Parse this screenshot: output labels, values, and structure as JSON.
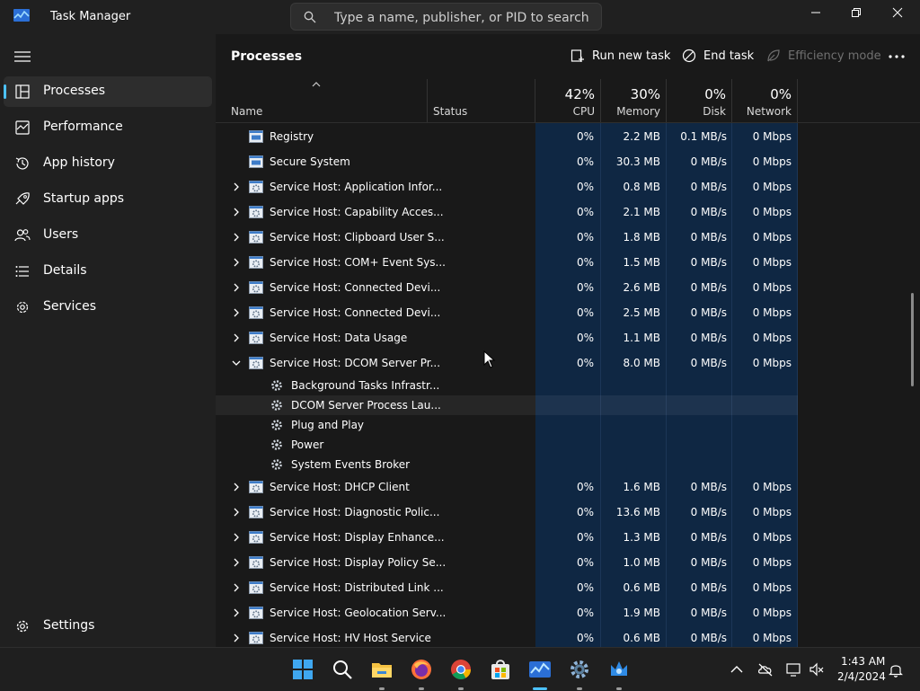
{
  "window": {
    "title": "Task Manager"
  },
  "search": {
    "placeholder": "Type a name, publisher, or PID to search"
  },
  "sidebar": {
    "items": [
      {
        "label": "Processes",
        "icon": "processes-icon",
        "active": true
      },
      {
        "label": "Performance",
        "icon": "performance-icon"
      },
      {
        "label": "App history",
        "icon": "app-history-icon"
      },
      {
        "label": "Startup apps",
        "icon": "startup-apps-icon"
      },
      {
        "label": "Users",
        "icon": "users-icon"
      },
      {
        "label": "Details",
        "icon": "details-icon"
      },
      {
        "label": "Services",
        "icon": "services-icon"
      }
    ],
    "settings_label": "Settings"
  },
  "page": {
    "title": "Processes"
  },
  "commands": {
    "run_new_task": "Run new task",
    "end_task": "End task",
    "efficiency_mode": "Efficiency mode"
  },
  "columns": {
    "name": "Name",
    "status": "Status",
    "cpu": {
      "label": "CPU",
      "percent": "42%"
    },
    "memory": {
      "label": "Memory",
      "percent": "30%"
    },
    "disk": {
      "label": "Disk",
      "percent": "0%"
    },
    "network": {
      "label": "Network",
      "percent": "0%"
    }
  },
  "rows": [
    {
      "name": "Registry",
      "type": "process",
      "expander": "none",
      "cpu": "0%",
      "memory": "2.2 MB",
      "disk": "0.1 MB/s",
      "network": "0 Mbps"
    },
    {
      "name": "Secure System",
      "type": "process",
      "expander": "none",
      "cpu": "0%",
      "memory": "30.3 MB",
      "disk": "0 MB/s",
      "network": "0 Mbps"
    },
    {
      "name": "Service Host: Application Infor...",
      "type": "service",
      "expander": "collapsed",
      "cpu": "0%",
      "memory": "0.8 MB",
      "disk": "0 MB/s",
      "network": "0 Mbps"
    },
    {
      "name": "Service Host: Capability Acces...",
      "type": "service",
      "expander": "collapsed",
      "cpu": "0%",
      "memory": "2.1 MB",
      "disk": "0 MB/s",
      "network": "0 Mbps"
    },
    {
      "name": "Service Host: Clipboard User S...",
      "type": "service",
      "expander": "collapsed",
      "cpu": "0%",
      "memory": "1.8 MB",
      "disk": "0 MB/s",
      "network": "0 Mbps"
    },
    {
      "name": "Service Host: COM+ Event Sys...",
      "type": "service",
      "expander": "collapsed",
      "cpu": "0%",
      "memory": "1.5 MB",
      "disk": "0 MB/s",
      "network": "0 Mbps"
    },
    {
      "name": "Service Host: Connected Devi...",
      "type": "service",
      "expander": "collapsed",
      "cpu": "0%",
      "memory": "2.6 MB",
      "disk": "0 MB/s",
      "network": "0 Mbps"
    },
    {
      "name": "Service Host: Connected Devi...",
      "type": "service",
      "expander": "collapsed",
      "cpu": "0%",
      "memory": "2.5 MB",
      "disk": "0 MB/s",
      "network": "0 Mbps"
    },
    {
      "name": "Service Host: Data Usage",
      "type": "service",
      "expander": "collapsed",
      "cpu": "0%",
      "memory": "1.1 MB",
      "disk": "0 MB/s",
      "network": "0 Mbps"
    },
    {
      "name": "Service Host: DCOM Server Pr...",
      "type": "service",
      "expander": "expanded",
      "cpu": "0%",
      "memory": "8.0 MB",
      "disk": "0 MB/s",
      "network": "0 Mbps"
    },
    {
      "name": "Background Tasks Infrastr...",
      "type": "child"
    },
    {
      "name": "DCOM Server Process Lau...",
      "type": "child",
      "highlight": true
    },
    {
      "name": "Plug and Play",
      "type": "child"
    },
    {
      "name": "Power",
      "type": "child"
    },
    {
      "name": "System Events Broker",
      "type": "child"
    },
    {
      "name": "Service Host: DHCP Client",
      "type": "service",
      "expander": "collapsed",
      "cpu": "0%",
      "memory": "1.6 MB",
      "disk": "0 MB/s",
      "network": "0 Mbps"
    },
    {
      "name": "Service Host: Diagnostic Polic...",
      "type": "service",
      "expander": "collapsed",
      "cpu": "0%",
      "memory": "13.6 MB",
      "disk": "0 MB/s",
      "network": "0 Mbps"
    },
    {
      "name": "Service Host: Display Enhance...",
      "type": "service",
      "expander": "collapsed",
      "cpu": "0%",
      "memory": "1.3 MB",
      "disk": "0 MB/s",
      "network": "0 Mbps"
    },
    {
      "name": "Service Host: Display Policy Se...",
      "type": "service",
      "expander": "collapsed",
      "cpu": "0%",
      "memory": "1.0 MB",
      "disk": "0 MB/s",
      "network": "0 Mbps"
    },
    {
      "name": "Service Host: Distributed Link ...",
      "type": "service",
      "expander": "collapsed",
      "cpu": "0%",
      "memory": "0.6 MB",
      "disk": "0 MB/s",
      "network": "0 Mbps"
    },
    {
      "name": "Service Host: Geolocation Serv...",
      "type": "service",
      "expander": "collapsed",
      "cpu": "0%",
      "memory": "1.9 MB",
      "disk": "0 MB/s",
      "network": "0 Mbps"
    },
    {
      "name": "Service Host: HV Host Service",
      "type": "service",
      "expander": "collapsed",
      "cpu": "0%",
      "memory": "0.6 MB",
      "disk": "0 MB/s",
      "network": "0 Mbps"
    }
  ],
  "taskbar": {
    "apps": [
      {
        "name": "start",
        "icon": "windows-start-icon"
      },
      {
        "name": "search",
        "icon": "search-icon"
      },
      {
        "name": "file-explorer",
        "icon": "folder-icon",
        "running": true
      },
      {
        "name": "firefox",
        "icon": "firefox-icon",
        "running": true
      },
      {
        "name": "chrome",
        "icon": "chrome-icon",
        "running": true
      },
      {
        "name": "microsoft-store",
        "icon": "store-icon"
      },
      {
        "name": "task-manager",
        "icon": "task-manager-icon",
        "running": true,
        "active": true
      },
      {
        "name": "settings",
        "icon": "gear-icon",
        "running": true
      },
      {
        "name": "app",
        "icon": "app-icon",
        "running": true
      }
    ],
    "time": "1:43 AM",
    "date": "2/4/2024"
  },
  "colors": {
    "accent": "#4cc2ff",
    "selected_column_bg": "#0f2743"
  }
}
